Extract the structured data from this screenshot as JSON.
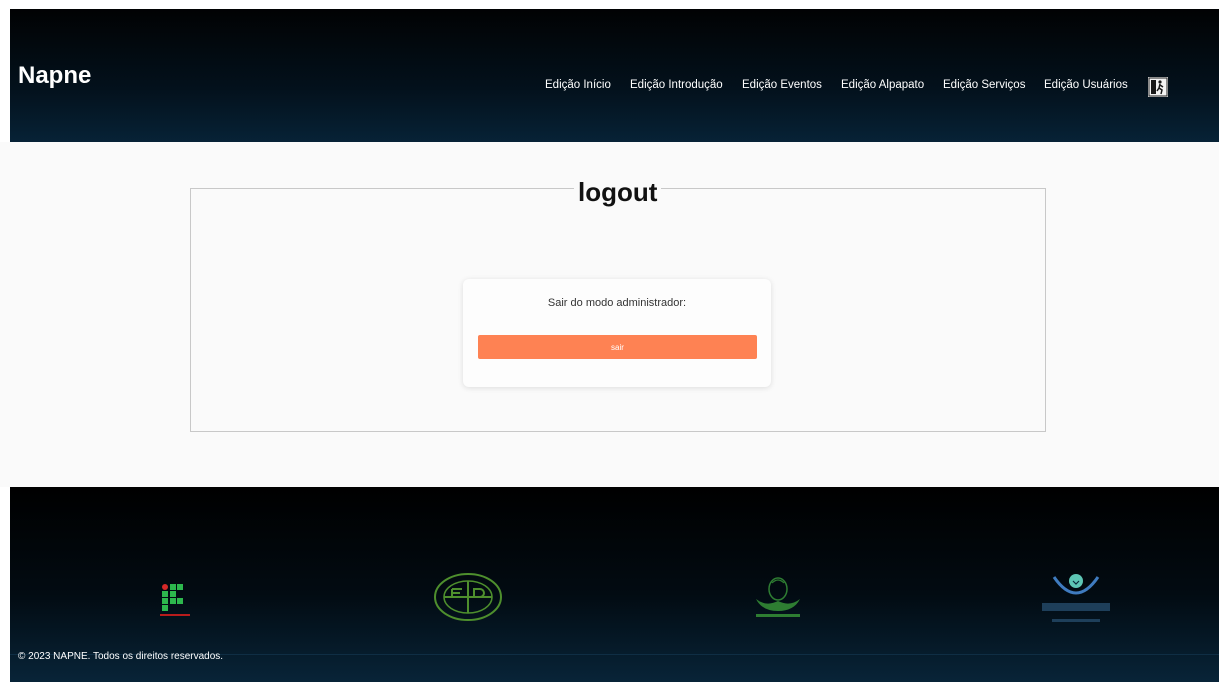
{
  "header": {
    "brand": "Napne",
    "nav": [
      {
        "label": "Edição Início"
      },
      {
        "label": "Edição Introdução"
      },
      {
        "label": "Edição Eventos"
      },
      {
        "label": "Edição Alpapato"
      },
      {
        "label": "Edição Serviços"
      },
      {
        "label": "Edição Usuários"
      }
    ],
    "exit_icon": "exit-icon"
  },
  "main": {
    "legend": "logout",
    "card": {
      "text": "Sair do modo administrador:",
      "button_label": "sair",
      "button_color": "#fe8253"
    }
  },
  "footer": {
    "copyright": "© 2023 NAPNE. Todos os direitos reservados.",
    "logos": [
      "if-logo",
      "escola-especial-logo",
      "apae-logo",
      "louis-braille-logo"
    ]
  }
}
